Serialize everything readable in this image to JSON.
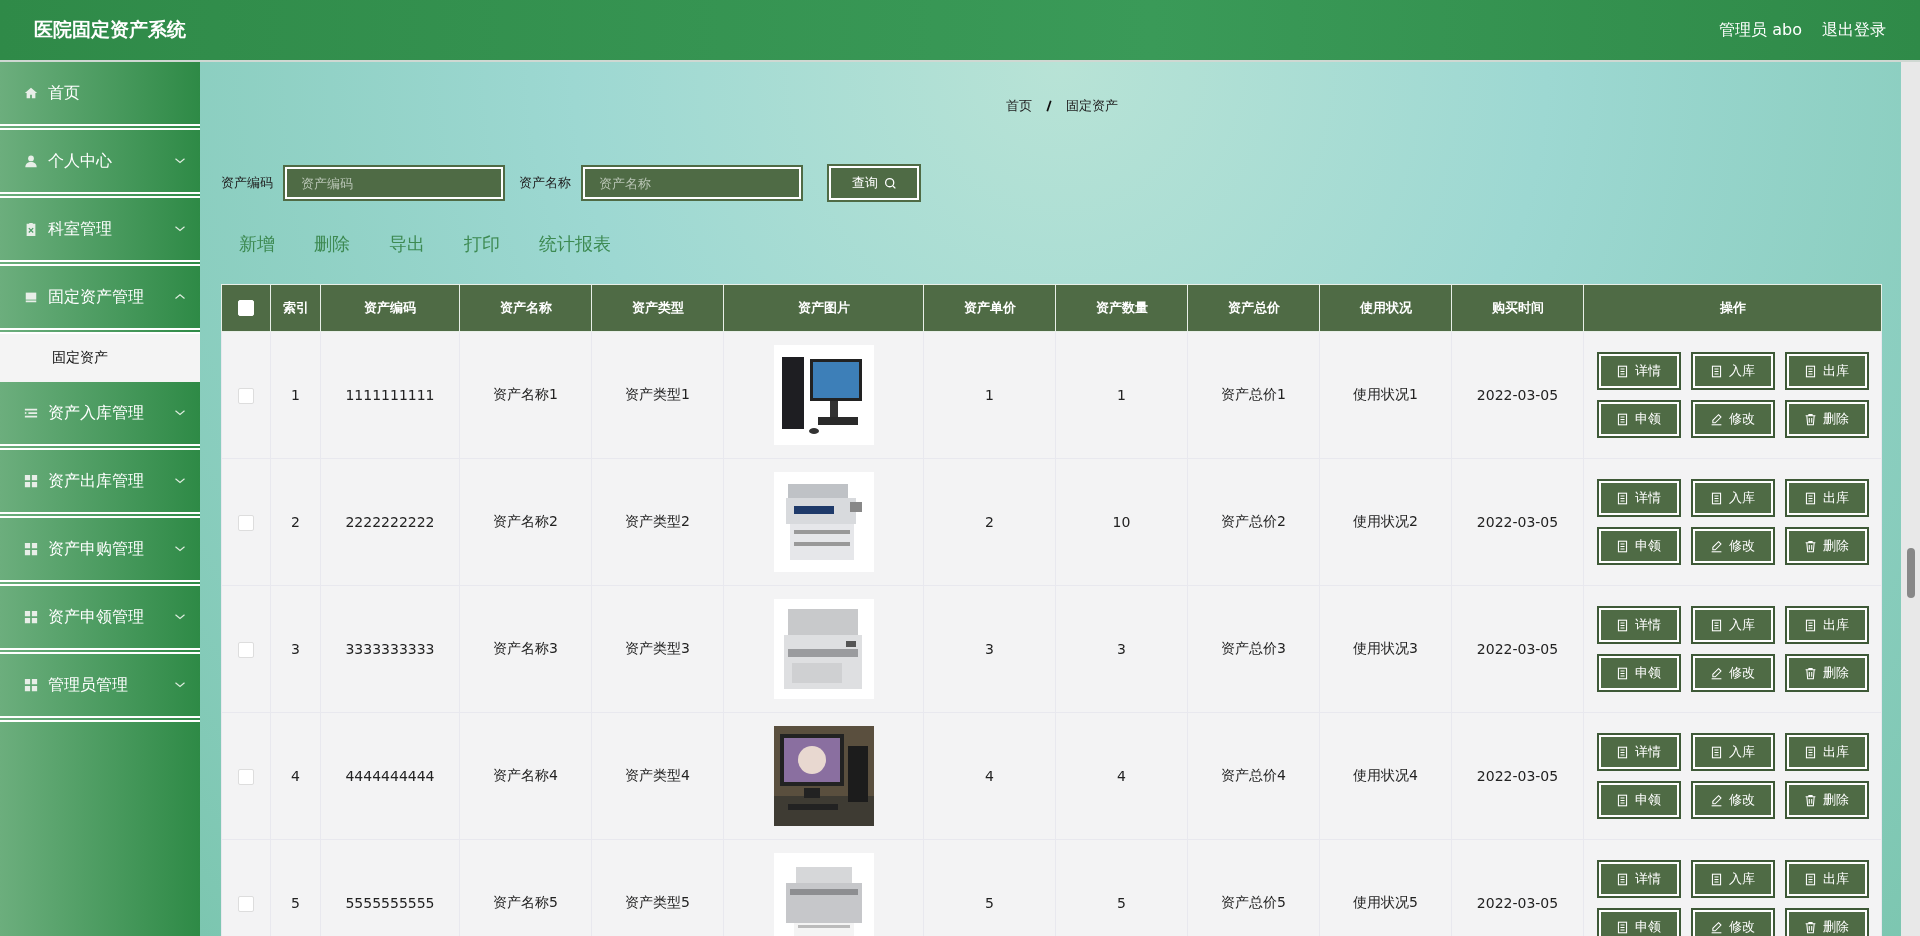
{
  "header": {
    "title": "医院固定资产系统",
    "user": "管理员 abo",
    "logout": "退出登录"
  },
  "sidebar": {
    "items": [
      {
        "label": "首页",
        "kind": "link"
      },
      {
        "label": "个人中心",
        "kind": "menu",
        "expanded": false
      },
      {
        "label": "科室管理",
        "kind": "menu",
        "expanded": false
      },
      {
        "label": "固定资产管理",
        "kind": "menu",
        "expanded": true,
        "children": [
          {
            "label": "固定资产",
            "selected": true
          }
        ]
      },
      {
        "label": "资产入库管理",
        "kind": "menu",
        "expanded": false
      },
      {
        "label": "资产出库管理",
        "kind": "menu",
        "expanded": false
      },
      {
        "label": "资产申购管理",
        "kind": "menu",
        "expanded": false
      },
      {
        "label": "资产申领管理",
        "kind": "menu",
        "expanded": false
      },
      {
        "label": "管理员管理",
        "kind": "menu",
        "expanded": false
      }
    ]
  },
  "breadcrumb": [
    "首页",
    "固定资产"
  ],
  "search": {
    "fields": [
      {
        "label": "资产编码",
        "placeholder": "资产编码"
      },
      {
        "label": "资产名称",
        "placeholder": "资产名称"
      }
    ],
    "button": "查询"
  },
  "actions": [
    "新增",
    "删除",
    "导出",
    "打印",
    "统计报表"
  ],
  "table": {
    "select_all_checked": false,
    "columns": [
      "索引",
      "资产编码",
      "资产名称",
      "资产类型",
      "资产图片",
      "资产单价",
      "资产数量",
      "资产总价",
      "使用状况",
      "购买时间",
      "操作"
    ],
    "rows": [
      {
        "checked": false,
        "cells": [
          "1",
          "1111111111",
          "资产名称1",
          "资产类型1",
          {
            "kind": "picture"
          },
          "1",
          "1",
          "资产总价1",
          "使用状况1",
          "2022-03-05"
        ],
        "buttons": [
          {
            "label": "详情",
            "kind": "doc"
          },
          {
            "label": "入库",
            "kind": "doc"
          },
          {
            "label": "出库",
            "kind": "doc"
          },
          {
            "label": "申领",
            "kind": "doc"
          },
          {
            "label": "修改",
            "kind": "edit"
          },
          {
            "label": "删除",
            "kind": "delete"
          }
        ]
      },
      {
        "checked": false,
        "cells": [
          "2",
          "2222222222",
          "资产名称2",
          "资产类型2",
          {
            "kind": "picture"
          },
          "2",
          "10",
          "资产总价2",
          "使用状况2",
          "2022-03-05"
        ],
        "buttons": [
          {
            "label": "详情",
            "kind": "doc"
          },
          {
            "label": "入库",
            "kind": "doc"
          },
          {
            "label": "出库",
            "kind": "doc"
          },
          {
            "label": "申领",
            "kind": "doc"
          },
          {
            "label": "修改",
            "kind": "edit"
          },
          {
            "label": "删除",
            "kind": "delete"
          }
        ]
      },
      {
        "checked": false,
        "cells": [
          "3",
          "3333333333",
          "资产名称3",
          "资产类型3",
          {
            "kind": "picture"
          },
          "3",
          "3",
          "资产总价3",
          "使用状况3",
          "2022-03-05"
        ],
        "buttons": [
          {
            "label": "详情",
            "kind": "doc"
          },
          {
            "label": "入库",
            "kind": "doc"
          },
          {
            "label": "出库",
            "kind": "doc"
          },
          {
            "label": "申领",
            "kind": "doc"
          },
          {
            "label": "修改",
            "kind": "edit"
          },
          {
            "label": "删除",
            "kind": "delete"
          }
        ]
      },
      {
        "checked": false,
        "cells": [
          "4",
          "4444444444",
          "资产名称4",
          "资产类型4",
          {
            "kind": "picture"
          },
          "4",
          "4",
          "资产总价4",
          "使用状况4",
          "2022-03-05"
        ],
        "buttons": [
          {
            "label": "详情",
            "kind": "doc"
          },
          {
            "label": "入库",
            "kind": "doc"
          },
          {
            "label": "出库",
            "kind": "doc"
          },
          {
            "label": "申领",
            "kind": "doc"
          },
          {
            "label": "修改",
            "kind": "edit"
          },
          {
            "label": "删除",
            "kind": "delete"
          }
        ]
      },
      {
        "checked": false,
        "cells": [
          "5",
          "5555555555",
          "资产名称5",
          "资产类型5",
          {
            "kind": "picture"
          },
          "5",
          "5",
          "资产总价5",
          "使用状况5",
          "2022-03-05"
        ],
        "buttons": [
          {
            "label": "详情",
            "kind": "doc"
          },
          {
            "label": "入库",
            "kind": "doc"
          },
          {
            "label": "出库",
            "kind": "doc"
          },
          {
            "label": "申领",
            "kind": "doc"
          },
          {
            "label": "修改",
            "kind": "edit"
          },
          {
            "label": "删除",
            "kind": "delete"
          }
        ]
      }
    ]
  }
}
